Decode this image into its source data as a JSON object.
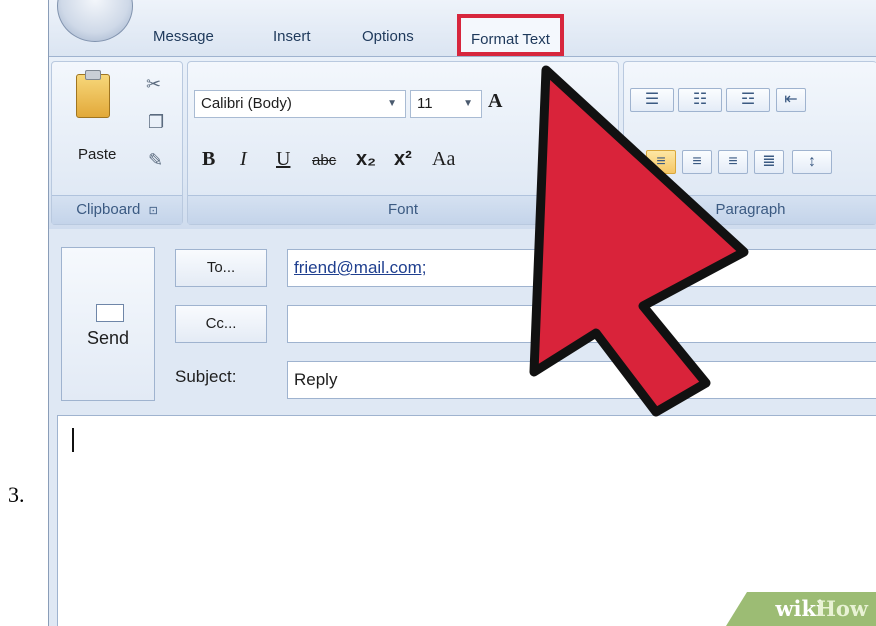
{
  "step_number": "3.",
  "tabs": [
    "Message",
    "Insert",
    "Options",
    "Format Text"
  ],
  "clipboard": {
    "paste_label": "Paste",
    "group_label": "Clipboard",
    "launcher": "⊡"
  },
  "font": {
    "name": "Calibri (Body)",
    "size": "11",
    "bold": "B",
    "italic": "I",
    "underline": "U",
    "strike": "abc",
    "subscript": "x₂",
    "superscript": "x²",
    "change_case": "Aa",
    "grow": "A",
    "group_label": "Font"
  },
  "paragraph": {
    "group_label": "Paragraph"
  },
  "compose": {
    "send_label": "Send",
    "to_label": "To...",
    "cc_label": "Cc...",
    "subject_label": "Subject:",
    "to_value": "friend@mail.com;",
    "subject_value": "Reply"
  },
  "watermark": {
    "wiki": "wiki",
    "how": "How"
  },
  "colors": {
    "highlight_box": "#d7263d",
    "arrow": "#d9233a"
  },
  "icons": [
    "office-orb-icon",
    "paste-icon",
    "cut-icon",
    "copy-icon",
    "format-painter-icon",
    "bullets-icon",
    "numbering-icon",
    "multilevel-list-icon",
    "decrease-indent-icon",
    "align-center-icon",
    "align-right-icon",
    "justify-icon",
    "line-spacing-icon",
    "send-envelope-icon",
    "pointer-arrow-icon"
  ]
}
